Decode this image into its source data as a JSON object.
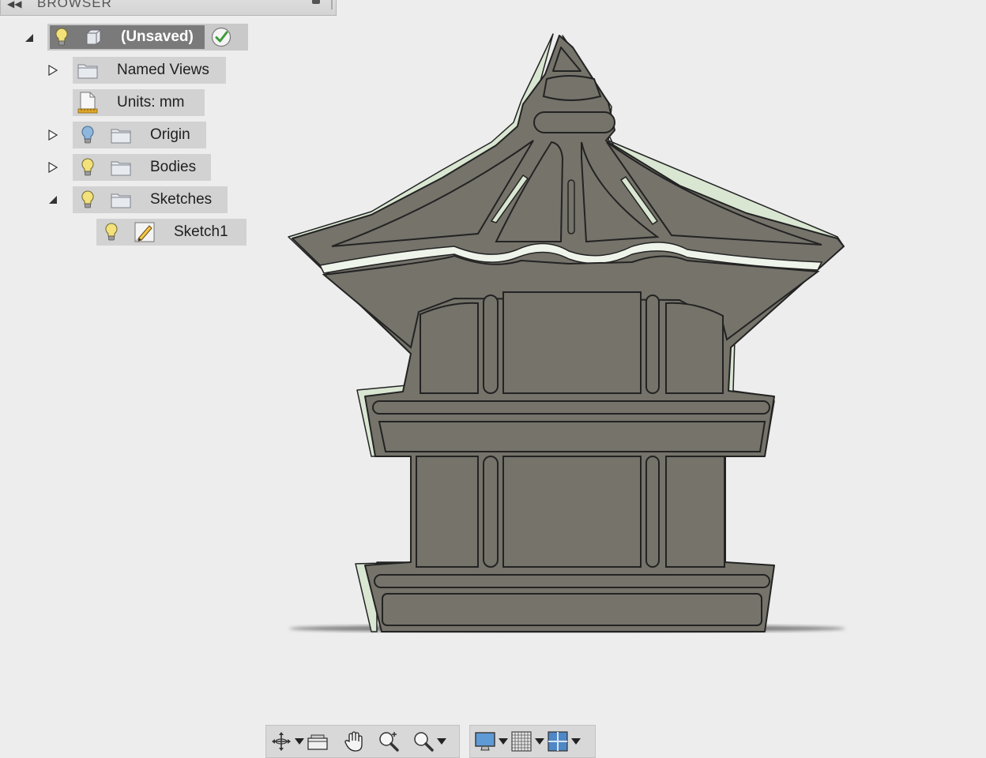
{
  "panel": {
    "title": "BROWSER",
    "collapse_icon": "double-chevron-left-icon",
    "pin_icon": "pin-icon"
  },
  "tree": {
    "root": {
      "label": "(Unsaved)",
      "status_icon": "check-circle-icon",
      "expanded": true
    },
    "items": [
      {
        "label": "Named Views",
        "icon": "folder-icon",
        "visible_toggle": false,
        "expanded": false
      },
      {
        "label": "Units: mm",
        "icon": "document-ruler-icon",
        "visible_toggle": false
      },
      {
        "label": "Origin",
        "icon": "folder-icon",
        "visible_toggle": true,
        "bulb_color": "#8fb6dc",
        "expanded": false
      },
      {
        "label": "Bodies",
        "icon": "folder-icon",
        "visible_toggle": true,
        "bulb_color": "#f3e27a",
        "expanded": false
      },
      {
        "label": "Sketches",
        "icon": "folder-icon",
        "visible_toggle": true,
        "bulb_color": "#f3e27a",
        "expanded": true
      },
      {
        "label": "Sketch1",
        "icon": "sketch-icon",
        "visible_toggle": true,
        "bulb_color": "#f3e27a"
      }
    ]
  },
  "model": {
    "body_color": "#75736a",
    "edge_color": "#232323",
    "highlight_color": "#d9e6d2"
  },
  "toolbar": {
    "navigation": [
      "orbit-icon",
      "look-at-icon",
      "pan-icon",
      "zoom-icon",
      "zoom-window-icon"
    ],
    "display": [
      "display-settings-icon",
      "grid-settings-icon",
      "viewports-icon"
    ]
  }
}
